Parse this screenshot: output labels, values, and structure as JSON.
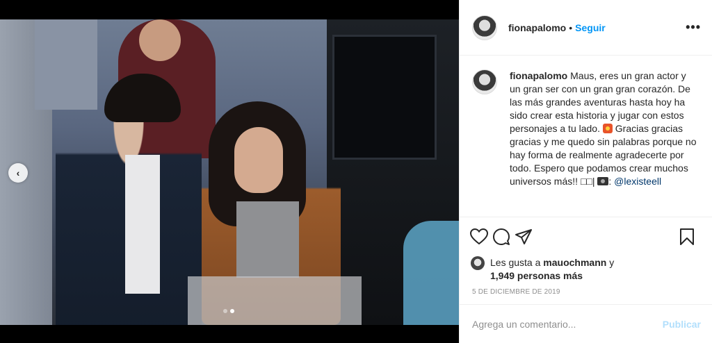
{
  "post": {
    "username": "fionapalomo",
    "separator": "•",
    "follow_label": "Seguir",
    "more_label": "•••"
  },
  "caption": {
    "username": "fionapalomo",
    "text_1": "Maus, eres un gran actor y un gran ser con un gran gran corazón. De las más grandes aventuras hasta hoy ha sido crear esta historia y jugar con estos personajes a tu lado.",
    "text_2": "Gracias gracias gracias y me quedo sin palabras porque no hay forma de realmente agradecerte por todo. Espero que podamos crear muchos universos más!! ",
    "text_3": "□□|",
    "mention": "@lexisteell",
    "emoji_1": "collision-emoji",
    "emoji_2": "camera-emoji"
  },
  "actions": {
    "like": "heart-icon",
    "comment": "comment-icon",
    "share": "share-icon",
    "save": "bookmark-icon"
  },
  "likes": {
    "prefix": "Les gusta a",
    "user": "mauochmann",
    "conjunction": "y",
    "others": "1,949 personas más"
  },
  "date": "5 DE DICIEMBRE DE 2019",
  "comment_box": {
    "placeholder": "Agrega un comentario...",
    "publish_label": "Publicar"
  },
  "carousel": {
    "prev_icon": "chevron-left-icon",
    "slides": 2,
    "active_slide": 2
  },
  "colors": {
    "accent": "#0095f6",
    "publish_disabled": "#b2dffc",
    "muted": "#8e8e8e",
    "text": "#262626"
  }
}
